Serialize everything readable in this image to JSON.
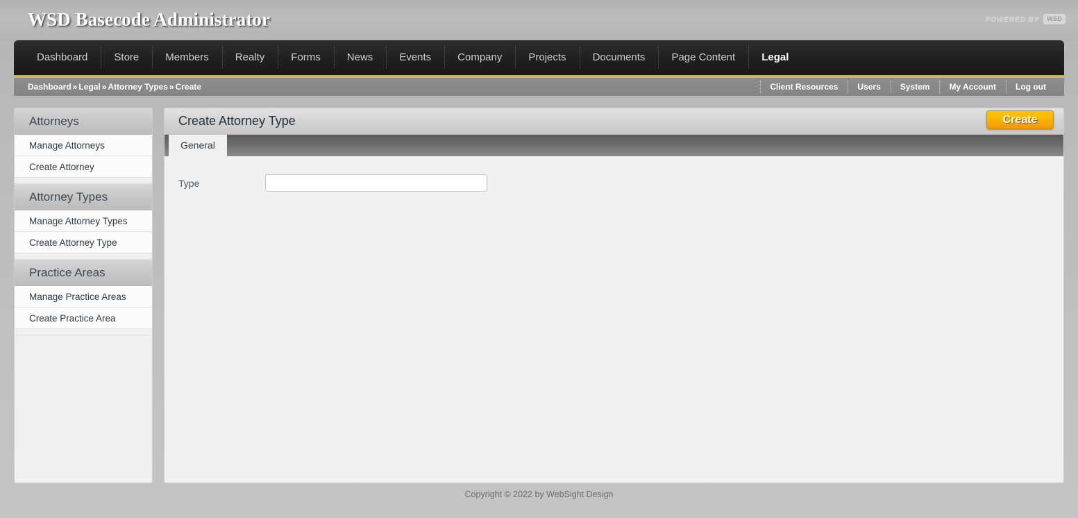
{
  "header": {
    "app_title": "WSD Basecode Administrator",
    "powered_by_text": "POWERED BY",
    "powered_by_logo": "WSD"
  },
  "main_nav": {
    "items": [
      {
        "label": "Dashboard",
        "active": false
      },
      {
        "label": "Store",
        "active": false
      },
      {
        "label": "Members",
        "active": false
      },
      {
        "label": "Realty",
        "active": false
      },
      {
        "label": "Forms",
        "active": false
      },
      {
        "label": "News",
        "active": false
      },
      {
        "label": "Events",
        "active": false
      },
      {
        "label": "Company",
        "active": false
      },
      {
        "label": "Projects",
        "active": false
      },
      {
        "label": "Documents",
        "active": false
      },
      {
        "label": "Page Content",
        "active": false
      },
      {
        "label": "Legal",
        "active": true
      }
    ]
  },
  "breadcrumb": {
    "separator": "»",
    "items": [
      "Dashboard",
      "Legal",
      "Attorney Types",
      "Create"
    ]
  },
  "user_links": {
    "items": [
      "Client Resources",
      "Users",
      "System",
      "My Account",
      "Log out"
    ]
  },
  "sidebar": {
    "groups": [
      {
        "title": "Attorneys",
        "items": [
          "Manage Attorneys",
          "Create Attorney"
        ]
      },
      {
        "title": "Attorney Types",
        "items": [
          "Manage Attorney Types",
          "Create Attorney Type"
        ]
      },
      {
        "title": "Practice Areas",
        "items": [
          "Manage Practice Areas",
          "Create Practice Area"
        ]
      }
    ]
  },
  "content": {
    "page_title": "Create Attorney Type",
    "create_button": "Create",
    "tabs": [
      {
        "label": "General",
        "active": true
      }
    ],
    "form": {
      "fields": [
        {
          "label": "Type",
          "value": "",
          "placeholder": ""
        }
      ]
    }
  },
  "footer": {
    "copyright": "Copyright © 2022 by WebSight Design"
  },
  "colors": {
    "accent_orange": "#e8a317",
    "button_gold": "#fcc200",
    "nav_dark": "#222222",
    "panel_bg": "#f0f0f0",
    "page_bg": "#bdbdbd"
  }
}
